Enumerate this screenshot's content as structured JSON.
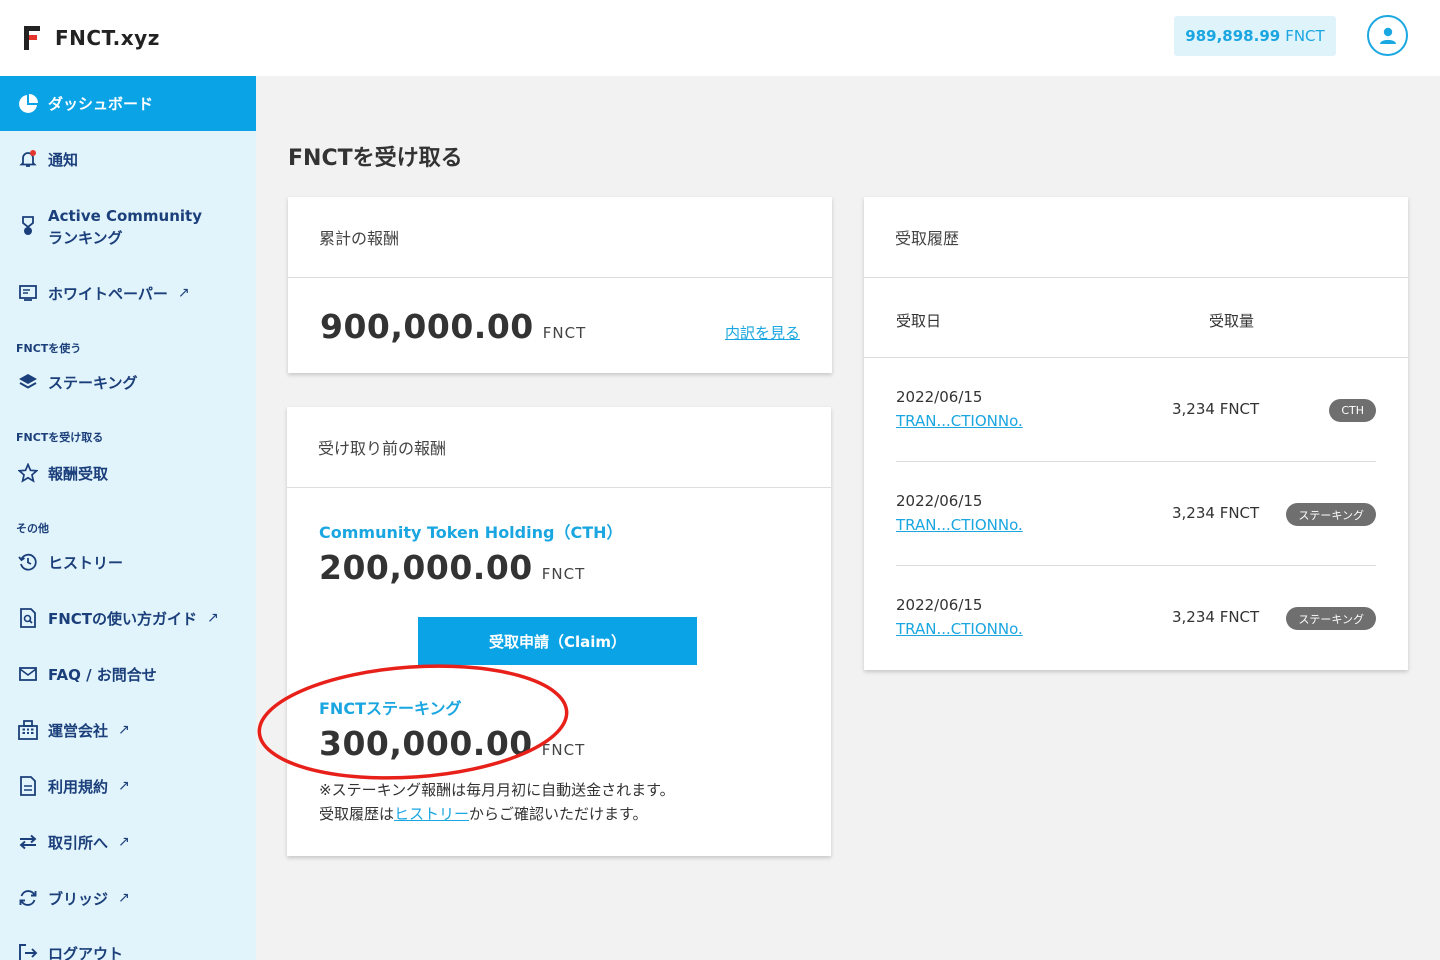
{
  "header": {
    "logo_text": "FNCT.xyz",
    "balance_value": "989,898.99",
    "balance_unit": "FNCT"
  },
  "sidebar": {
    "active_item": "ダッシュボード",
    "items": {
      "notifications": "通知",
      "ranking_line1": "Active Community",
      "ranking_line2": "ランキング",
      "whitepaper": "ホワイトペーパー",
      "section_use": "FNCTを使う",
      "staking": "ステーキング",
      "section_receive": "FNCTを受け取る",
      "rewards": "報酬受取",
      "section_other": "その他",
      "history": "ヒストリー",
      "guide": "FNCTの使い方ガイド",
      "faq": "FAQ / お問合せ",
      "company": "運営会社",
      "terms": "利用規約",
      "exchange": "取引所へ",
      "bridge": "ブリッジ",
      "logout": "ログアウト"
    },
    "external_mark": "↗"
  },
  "main": {
    "page_title": "FNCTを受け取る",
    "cumulative": {
      "title": "累計の報酬",
      "amount": "900,000.00",
      "unit": "FNCT",
      "breakdown_link": "内訳を見る"
    },
    "pending": {
      "title": "受け取り前の報酬",
      "cth_label": "Community Token Holding（CTH）",
      "cth_amount": "200,000.00",
      "cth_unit": "FNCT",
      "claim_button": "受取申請（Claim）",
      "staking_label": "FNCTステーキング",
      "staking_amount": "300,000.00",
      "staking_unit": "FNCT",
      "note_line1": "※ステーキング報酬は毎月月初に自動送金されます。",
      "note_line2_prefix": "受取履歴は",
      "note_line2_link": "ヒストリー",
      "note_line2_suffix": "からご確認いただけます。"
    },
    "history": {
      "title": "受取履歴",
      "col_date": "受取日",
      "col_amount": "受取量",
      "rows": [
        {
          "date": "2022/06/15",
          "tx": "TRAN...CTIONNo.",
          "amount": "3,234 FNCT",
          "badge": "CTH"
        },
        {
          "date": "2022/06/15",
          "tx": "TRAN...CTIONNo.",
          "amount": "3,234 FNCT",
          "badge": "ステーキング"
        },
        {
          "date": "2022/06/15",
          "tx": "TRAN...CTIONNo.",
          "amount": "3,234 FNCT",
          "badge": "ステーキング"
        }
      ]
    }
  },
  "colors": {
    "accent": "#0aa3e6",
    "sidebar_bg": "#e1f3fb",
    "nav_text": "#1b3f7a",
    "annotation_circle": "#e8201a"
  }
}
